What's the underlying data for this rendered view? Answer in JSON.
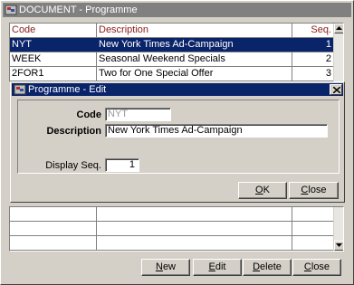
{
  "window": {
    "title": "DOCUMENT - Programme"
  },
  "grid": {
    "columns": [
      "Code",
      "Description",
      "Seq."
    ],
    "rows": [
      {
        "code": "NYT",
        "description": "New York Times Ad-Campaign",
        "seq": "1",
        "selected": true
      },
      {
        "code": "WEEK",
        "description": "Seasonal Weekend Specials",
        "seq": "2",
        "selected": false
      },
      {
        "code": "2FOR1",
        "description": "Two for One Special Offer",
        "seq": "3",
        "selected": false
      }
    ]
  },
  "dialog": {
    "title": "Programme - Edit",
    "code_label": "Code",
    "code_value": "NYT",
    "description_label": "Description",
    "description_value": "New York Times Ad-Campaign",
    "display_seq_label": "Display Seq.",
    "display_seq_value": "1",
    "ok_button": {
      "label": "OK",
      "mnemonic": "O",
      "rest": "K"
    },
    "close_button": {
      "label": "Close",
      "mnemonic": "C",
      "rest": "lose"
    }
  },
  "toolbar": {
    "new_button": {
      "label": "New",
      "mnemonic": "N",
      "rest": "ew"
    },
    "edit_button": {
      "label": "Edit",
      "mnemonic": "E",
      "rest": "dit"
    },
    "delete_button": {
      "label": "Delete",
      "mnemonic": "D",
      "rest": "elete"
    },
    "close_button": {
      "label": "Close",
      "mnemonic": "C",
      "rest": "lose"
    }
  },
  "colors": {
    "selection": "#0a246a",
    "header_text": "#8b1a1a",
    "inactive_title": "#808080",
    "face": "#d4d0c8"
  }
}
